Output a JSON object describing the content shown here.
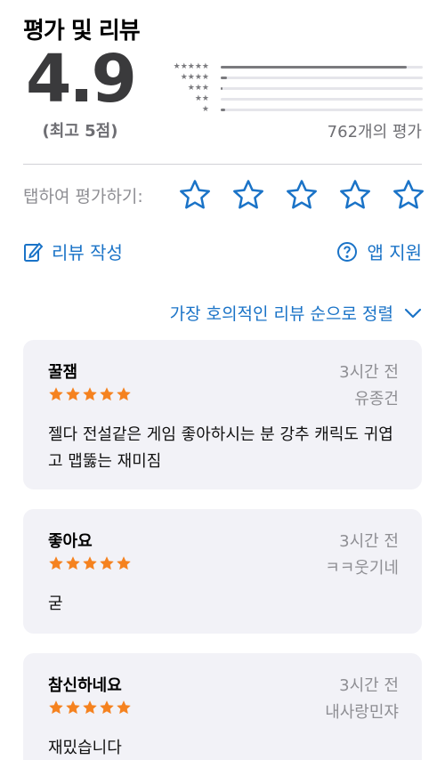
{
  "ratings": {
    "section_title": "평가 및 리뷰",
    "average": "4.9",
    "out_of": "(최고 5점)",
    "count": "762개의 평가",
    "histogram": [
      {
        "stars": 5,
        "fraction": 0.92
      },
      {
        "stars": 4,
        "fraction": 0.03
      },
      {
        "stars": 3,
        "fraction": 0.01
      },
      {
        "stars": 2,
        "fraction": 0.0
      },
      {
        "stars": 1,
        "fraction": 0.02
      }
    ]
  },
  "tap_to_rate": {
    "label": "탭하여 평가하기:",
    "stars": 5,
    "color": "#1a73c7"
  },
  "actions": {
    "write_review": "리뷰 작성",
    "app_support": "앱 지원"
  },
  "sort": {
    "label": "가장 호의적인 리뷰 순으로 정렬"
  },
  "reviews": [
    {
      "title": "꿀잼",
      "date": "3시간 전",
      "author": "유종건",
      "stars": 5,
      "body": "젤다 전설같은 게임 좋아하시는 분 강추 캐릭도 귀엽고 맵뚫는 재미짐"
    },
    {
      "title": "좋아요",
      "date": "3시간 전",
      "author": "ㅋㅋ웃기네",
      "stars": 5,
      "body": "굳"
    },
    {
      "title": "참신하네요",
      "date": "3시간 전",
      "author": "내사랑민쟈",
      "stars": 5,
      "body": "재밌습니다"
    }
  ],
  "colors": {
    "accent": "#1a73c7",
    "review_star": "#f5821f",
    "card_bg": "#f2f2f7"
  }
}
